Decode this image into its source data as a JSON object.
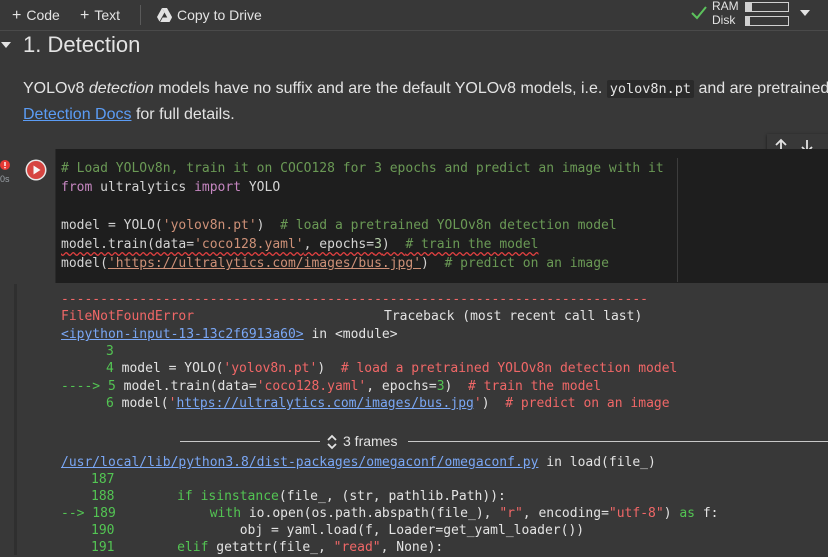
{
  "toolbar": {
    "code_label": "Code",
    "text_label": "Text",
    "copy_drive_label": "Copy to Drive",
    "ram_label": "RAM",
    "disk_label": "Disk",
    "ram_usage": 0.15,
    "disk_usage": 0.1
  },
  "section": {
    "heading": "1. Detection",
    "desc_part1": "YOLOv8 ",
    "desc_em": "detection",
    "desc_part2": " models have no suffix and are the default YOLOv8 models, i.e. ",
    "desc_code": "yolov8n.pt",
    "desc_part3": " and are pretrained on",
    "desc_link": "Detection Docs",
    "desc_part4": " for full details."
  },
  "cell": {
    "exec_time": "0s",
    "line1": "# Load YOLOv8n, train it on COCO128 for 3 epochs and predict an image with it",
    "line2_kw1": "from",
    "line2_mod": " ultralytics ",
    "line2_kw2": "import",
    "line2_name": " YOLO",
    "line4_a": "model = YOLO(",
    "line4_str": "'yolov8n.pt'",
    "line4_b": ")  ",
    "line4_comment": "# load a pretrained YOLOv8n detection model",
    "line5_a": "model.train(data=",
    "line5_str": "'coco128.yaml'",
    "line5_b": ", epochs=",
    "line5_num": "3",
    "line5_c": ")  ",
    "line5_comment": "# train the model",
    "line6_a": "model(",
    "line6_str": "'https://ultralytics.com/images/bus.jpg'",
    "line6_b": ")  ",
    "line6_comment": "# predict on an image"
  },
  "output": {
    "dash_rule": "---------------------------------------------------------------------------",
    "error_name": "FileNotFoundError",
    "traceback_label": "Traceback (most recent call last)",
    "input_link": "<ipython-input-13-13c2f6913a60>",
    "in_module": " in <module>",
    "tb": {
      "n3": "3",
      "n4": "4",
      "l4_a": " model = YOLO(",
      "l4_str": "'yolov8n.pt'",
      "l4_b": ")  ",
      "l4_comment": "# load a pretrained YOLOv8n detection model",
      "arrow5": "----> 5",
      "l5_a": " model.train(data=",
      "l5_str": "'coco128.yaml'",
      "l5_b": ", epochs=",
      "l5_num": "3",
      "l5_c": ")  ",
      "l5_comment": "# train the model",
      "n6": "6",
      "l6_a": " model(",
      "l6_q1": "'",
      "l6_url": "https://ultralytics.com/images/bus.jpg",
      "l6_q2": "'",
      "l6_b": ")  ",
      "l6_comment": "# predict on an image"
    },
    "frames_label": "3 frames",
    "file_link": "/usr/local/lib/python3.8/dist-packages/omegaconf/omegaconf.py",
    "in_load": " in load(file_)",
    "f187": "187",
    "f188": "188",
    "l188_a": "if ",
    "l188_fn": "isinstance",
    "l188_b": "(file_, (str, pathlib.Path)):",
    "arrow189": "--> 189",
    "l189_a": "with ",
    "l189_b": "io.open(os.path.abspath(file_), ",
    "l189_s1": "\"r\"",
    "l189_c": ", encoding=",
    "l189_s2": "\"utf-8\"",
    "l189_d": ") ",
    "l189_as": "as",
    "l189_e": " f:",
    "f190": "190",
    "l190": "obj = yaml.load(f, Loader=get_yaml_loader())",
    "f191": "191",
    "l191_a": "elif ",
    "l191_b": "getattr(file_, ",
    "l191_s": "\"read\"",
    "l191_c": ", None):"
  }
}
